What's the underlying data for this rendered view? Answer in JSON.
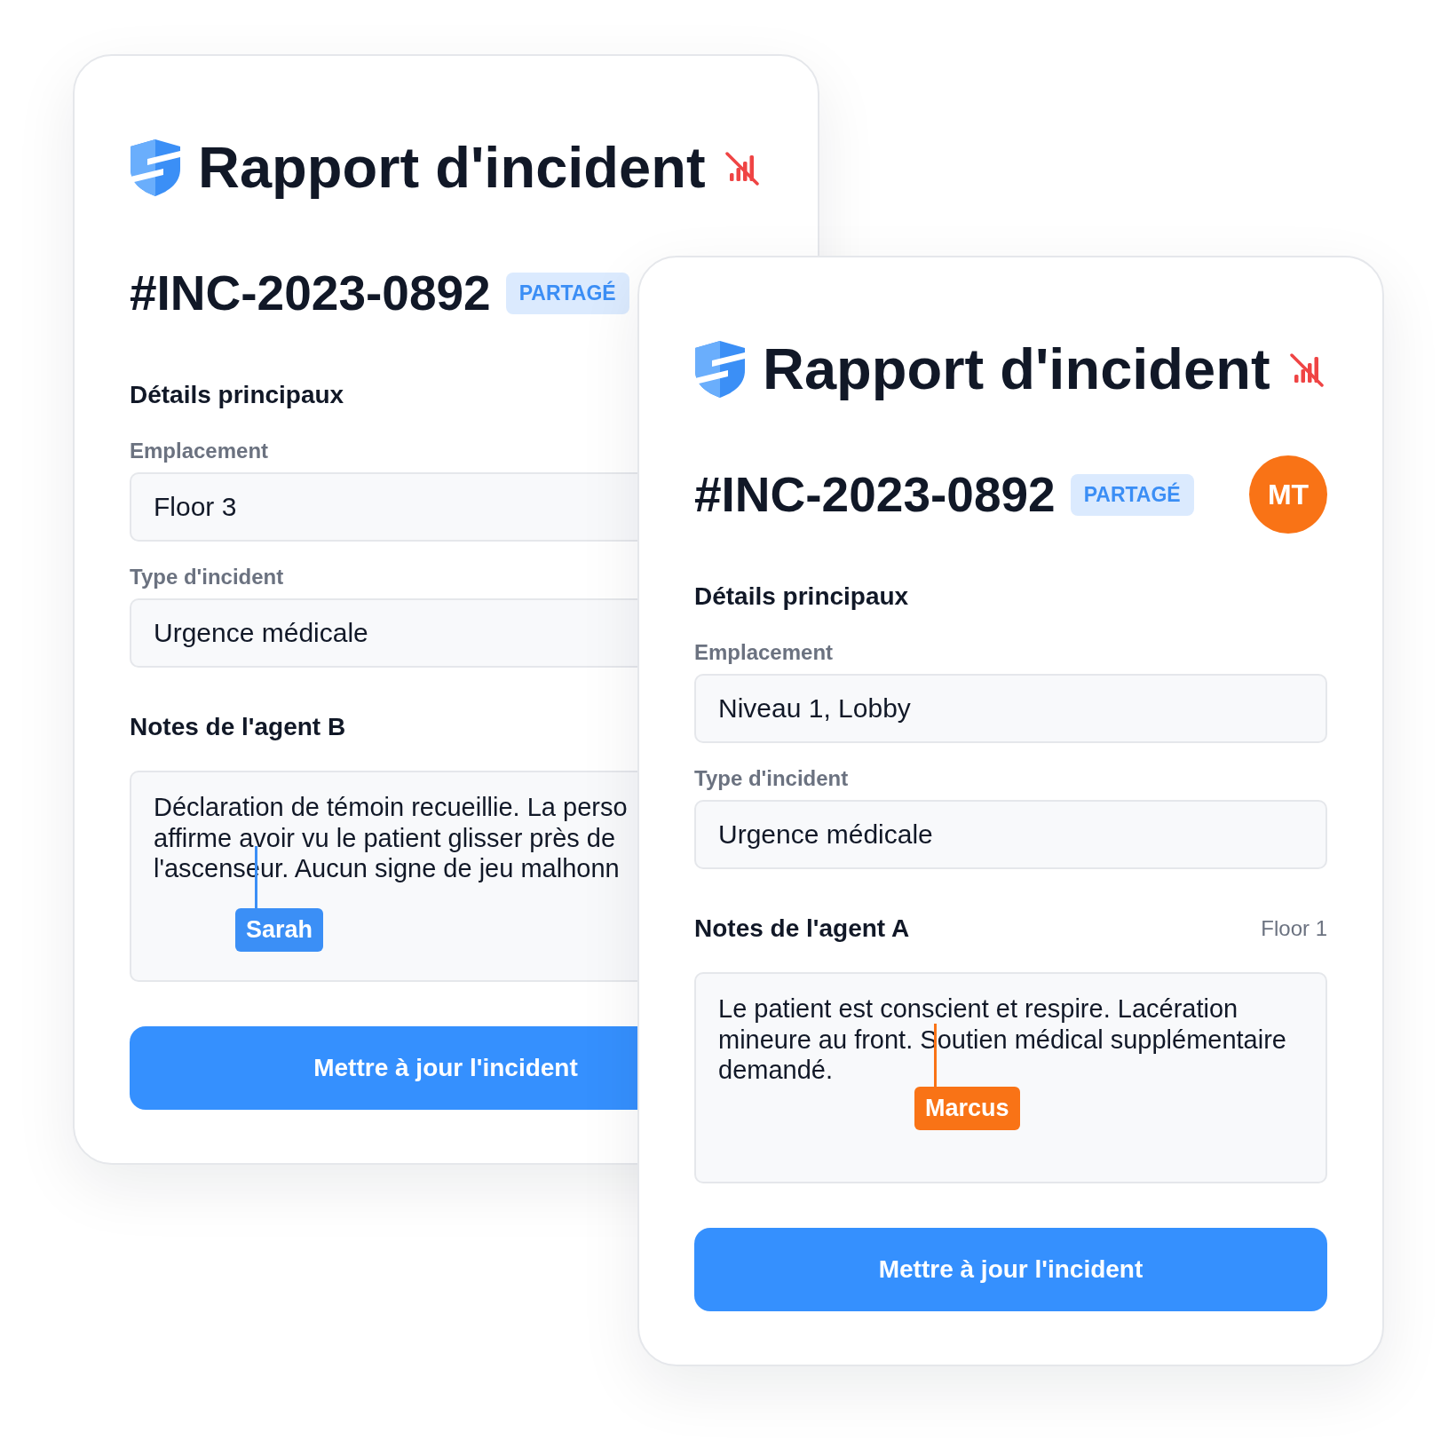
{
  "cards": [
    {
      "title": "Rapport d'incident",
      "incident_id": "#INC-2023-0892",
      "badge": "PARTAGÉ",
      "section_title": "Détails principaux",
      "fields": [
        {
          "label": "Emplacement",
          "value": "Floor 3"
        },
        {
          "label": "Type d'incident",
          "value": "Urgence médicale"
        }
      ],
      "notes": {
        "title": "Notes de l'agent B",
        "lines": [
          "Déclaration de témoin recueillie. La perso",
          "affirme avoir vu le patient glisser près de",
          "l'ascenseur. Aucun signe de jeu malhonn"
        ]
      },
      "cursor": {
        "name": "Sarah",
        "color": "#3b8ff6"
      },
      "button": "Mettre à jour l'incident"
    },
    {
      "title": "Rapport d'incident",
      "incident_id": "#INC-2023-0892",
      "badge": "PARTAGÉ",
      "avatar": {
        "initials": "MT"
      },
      "section_title": "Détails principaux",
      "fields": [
        {
          "label": "Emplacement",
          "value": "Niveau 1, Lobby"
        },
        {
          "label": "Type d'incident",
          "value": "Urgence médicale"
        }
      ],
      "notes": {
        "title": "Notes de l'agent A",
        "meta": "Floor 1",
        "lines": [
          "Le patient est conscient et respire. Lacération",
          "mineure au front. Soutien médical supplémentaire",
          "demandé."
        ]
      },
      "cursor": {
        "name": "Marcus",
        "color": "#f97316"
      },
      "button": "Mettre à jour l'incident"
    }
  ]
}
